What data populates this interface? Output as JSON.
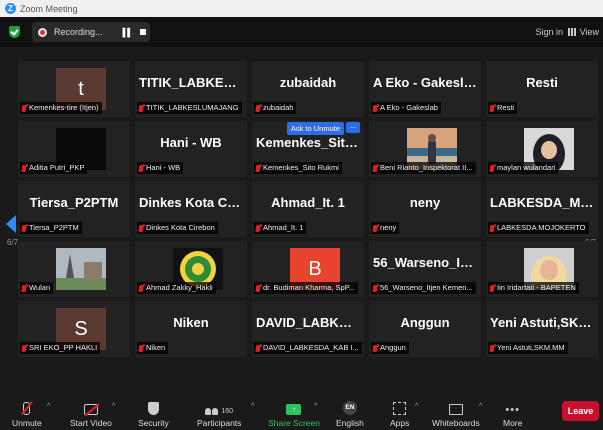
{
  "window": {
    "title": "Zoom Meeting"
  },
  "topbar": {
    "recording": "Recording...",
    "sign_in": "Sign in",
    "view": "View"
  },
  "page_left": "6/7",
  "page_right": "6/7",
  "tiles": [
    {
      "big": "t",
      "label": "Kemenkes-tire (Itjen)",
      "type": "avatar",
      "bg": "#5a3a30"
    },
    {
      "big": "TITIK_LABKESL...",
      "label": "TITIK_LABKESLUMAJANG",
      "type": "name"
    },
    {
      "big": "zubaidah",
      "label": "zubaidah",
      "type": "name"
    },
    {
      "big": "A Eko - Gakeslab",
      "label": "A Eko - Gakeslab",
      "type": "name"
    },
    {
      "big": "Resti",
      "label": "Resti",
      "type": "name"
    },
    {
      "big": "",
      "label": "Aditia Putri_PKP",
      "type": "dark"
    },
    {
      "big": "Hani - WB",
      "label": "Hani - WB",
      "type": "name"
    },
    {
      "big": "Kemenkes_Sito...",
      "label": "Kemenkes_Sito Rukmi",
      "type": "name",
      "unmute": "Ask to Unmute",
      "more": "..."
    },
    {
      "big": "",
      "label": "Beni Rianto_Inspektorat II...",
      "type": "photo-beach"
    },
    {
      "big": "",
      "label": "maylan wulandari",
      "type": "photo-hijab"
    },
    {
      "big": "Tiersa_P2PTM",
      "label": "Tiersa_P2PTM",
      "type": "name"
    },
    {
      "big": "Dinkes Kota Cir...",
      "label": "Dinkes Kota Cirebon",
      "type": "name"
    },
    {
      "big": "Ahmad_It. 1",
      "label": "Ahmad_It. 1",
      "type": "name"
    },
    {
      "big": "neny",
      "label": "neny",
      "type": "name"
    },
    {
      "big": "LABKESDA_MO...",
      "label": "LABKESDA MOJOKERTO",
      "type": "name"
    },
    {
      "big": "",
      "label": "Wulan",
      "type": "photo-paris"
    },
    {
      "big": "",
      "label": "Ahmad Zakky_Hakli",
      "type": "photo-logo"
    },
    {
      "big": "B",
      "label": "dr. Budiman Kharma, SpP...",
      "type": "avatar",
      "bg": "#e8432e"
    },
    {
      "big": "56_Warseno_Itj...",
      "label": "56_Warseno_Itjen Kemen...",
      "type": "name"
    },
    {
      "big": "",
      "label": "Iin Iridartati - BAPETEN",
      "type": "photo-hijab2"
    },
    {
      "big": "S",
      "label": "SRI EKO_PP HAKLI",
      "type": "avatar",
      "bg": "#5a3a30"
    },
    {
      "big": "Niken",
      "label": "Niken",
      "type": "name"
    },
    {
      "big": "DAVID_LABKES...",
      "label": "DAVID_LABKESDA_KAB I...",
      "type": "name"
    },
    {
      "big": "Anggun",
      "label": "Anggun",
      "type": "name"
    },
    {
      "big": "Yeni Astuti,SKM...",
      "label": "Yeni Astuti,SKM.MM",
      "type": "name"
    }
  ],
  "toolbar": {
    "unmute": "Unmute",
    "start_video": "Start Video",
    "security": "Security",
    "participants": "Participants",
    "participant_count": "160",
    "share": "Share Screen",
    "english": "English",
    "en_badge": "EN",
    "apps": "Apps",
    "whiteboards": "Whiteboards",
    "more": "More",
    "leave": "Leave"
  }
}
